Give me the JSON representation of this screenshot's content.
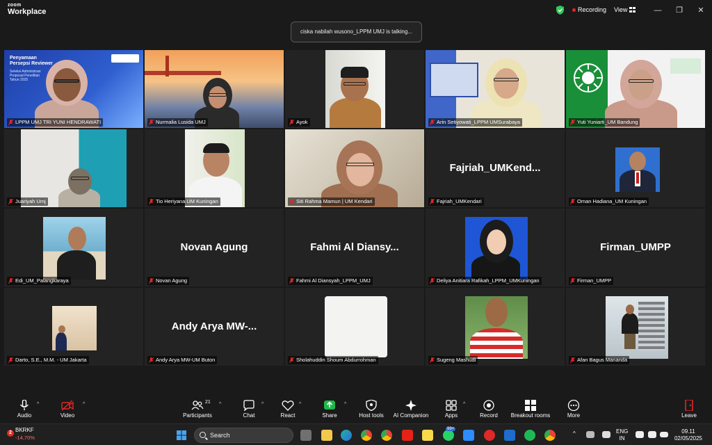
{
  "app": {
    "brand_top": "zoom",
    "brand_bottom": "Workplace"
  },
  "titlebar": {
    "recording": "Recording",
    "view": "View"
  },
  "talking_banner": "ciska nabilah wusono_LPPM UMJ is talking...",
  "participants": [
    {
      "label": "LPPM UMJ TRI YUNI HENDRAWATI",
      "slide_lines": [
        "Penyamaan",
        "Persepsi Reviewer",
        "Seleksi Administrasi",
        "Proposal Penelitian"
      ],
      "slide_footer": "Tahun 2025"
    },
    {
      "label": "Nurmalia Lusida UMJ"
    },
    {
      "label": "Ayok"
    },
    {
      "label": "Arin Setiyowati_LPPM UMSurabaya"
    },
    {
      "label": "Yuti Yuniarti_UM Bandung"
    },
    {
      "label": "Juariyah Umj"
    },
    {
      "label": "Tio Heriyana UM Kuningan"
    },
    {
      "label": "Siti Rahma Mamun | UM Kendari"
    },
    {
      "label": "Fajriah_UMKendari",
      "big_name": "Fajriah_UMKend..."
    },
    {
      "label": "Oman Hadiana_UM Kuningan"
    },
    {
      "label": "Edi_UM_Palangkaraya"
    },
    {
      "label": "Novan Agung",
      "big_name": "Novan Agung"
    },
    {
      "label": "Fahmi Al Diansyah_LPPM_UMJ",
      "big_name": "Fahmi Al Diansy..."
    },
    {
      "label": "Deliya Anitiara Rafikah_LPPM_UMKuningan"
    },
    {
      "label": "Firman_UMPP",
      "big_name": "Firman_UMPP"
    },
    {
      "label": "Darto, S.E., M.M. - UM Jakarta"
    },
    {
      "label": "Andy Arya MW-UM Buton",
      "big_name": "Andy Arya MW-..."
    },
    {
      "label": "Sholahuddin Shoum Abdurrohman"
    },
    {
      "label": "Sugeng Mashudi"
    },
    {
      "label": "Afan Bagus Mananda"
    }
  ],
  "toolbar": {
    "audio": "Audio",
    "video": "Video",
    "participants": "Participants",
    "participants_count": "21",
    "chat": "Chat",
    "react": "React",
    "share": "Share",
    "host_tools": "Host tools",
    "ai_companion": "AI Companion",
    "apps": "Apps",
    "record": "Record",
    "breakout": "Breakout rooms",
    "more": "More",
    "leave": "Leave"
  },
  "taskbar": {
    "stock_name": "BKRKF",
    "stock_change": "-14,70%",
    "stock_badge": "2",
    "search": "Search",
    "lang_top": "ENG",
    "lang_bottom": "IN",
    "time": "09.11",
    "date": "02/05/2025",
    "app_badge": "99+"
  },
  "colors": {
    "speaking_outline": "#2ec95c",
    "recording_dot": "#e02828",
    "mic_muted": "#e02828",
    "share_green": "#1dba4a",
    "video_muted": "#e02828"
  }
}
